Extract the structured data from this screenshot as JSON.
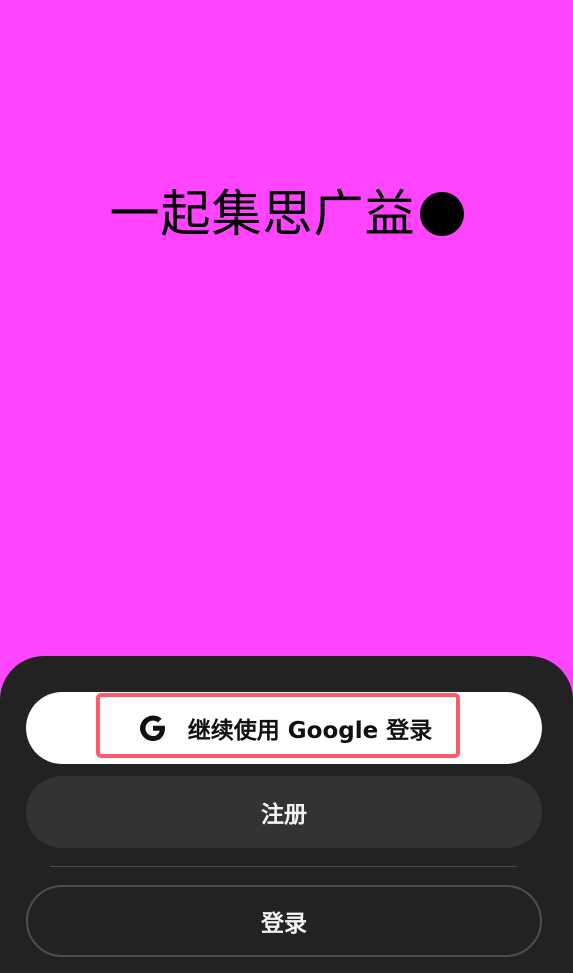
{
  "hero": {
    "headline": "一起集思广益",
    "background_color": "#ff44ff"
  },
  "auth": {
    "google_button_label": "继续使用 Google 登录",
    "register_label": "注册",
    "login_label": "登录",
    "highlight_color": "#ff5a6a"
  },
  "icons": {
    "google": "google-g-icon",
    "headline_dot": "filled-circle"
  }
}
